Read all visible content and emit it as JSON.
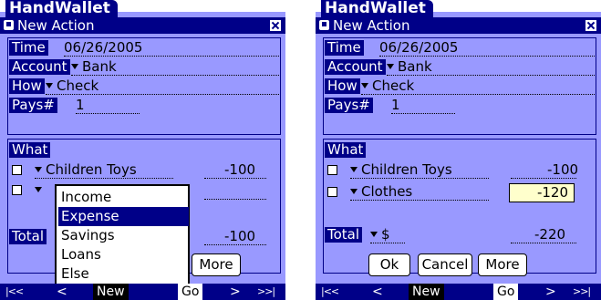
{
  "left": {
    "app_title": "HandWallet",
    "form_title": "New Action",
    "fields": {
      "time_label": "Time",
      "time_value": "06/26/2005",
      "account_label": "Account",
      "account_value": "Bank",
      "how_label": "How",
      "how_value": "Check",
      "pays_label": "Pays#",
      "pays_value": "1"
    },
    "what_label": "What",
    "items": [
      {
        "name": "Children Toys",
        "amount": "-100"
      },
      {
        "name": "",
        "amount": ""
      }
    ],
    "total_label": "Total",
    "total_amount": "-100",
    "more_button": "More",
    "dropdown": {
      "options": [
        "Income",
        "Expense",
        "Savings",
        "Loans",
        "Else"
      ],
      "selected": "Expense"
    },
    "taskbar": {
      "first": "|<<",
      "prev": "<",
      "new": "New",
      "go": "Go",
      "next": ">",
      "last": ">>|"
    }
  },
  "right": {
    "app_title": "HandWallet",
    "form_title": "New Action",
    "fields": {
      "time_label": "Time",
      "time_value": "06/26/2005",
      "account_label": "Account",
      "account_value": "Bank",
      "how_label": "How",
      "how_value": "Check",
      "pays_label": "Pays#",
      "pays_value": "1"
    },
    "what_label": "What",
    "items": [
      {
        "name": "Children Toys",
        "amount": "-100"
      },
      {
        "name": "Clothes",
        "amount": "-120"
      }
    ],
    "total_label": "Total",
    "total_currency": "$",
    "total_amount": "-220",
    "buttons": {
      "ok": "Ok",
      "cancel": "Cancel",
      "more": "More"
    },
    "taskbar": {
      "first": "|<<",
      "prev": "<",
      "new": "New",
      "go": "Go",
      "next": ">",
      "last": ">>|"
    }
  },
  "colors": {
    "background": "#9999ff",
    "accent": "#000088",
    "highlight": "#ffffcc"
  }
}
